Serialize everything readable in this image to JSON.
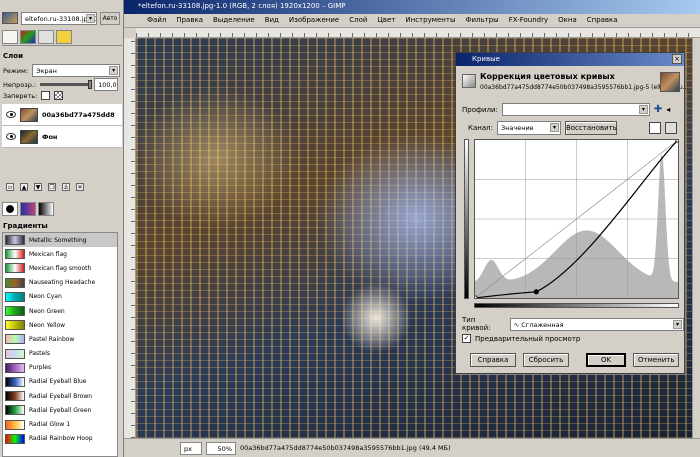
{
  "dock": {
    "image_selector": "eltefon.ru-33108.jpg-1",
    "auto_button": "Авто",
    "layers_title": "Слои",
    "mode_label": "Режим:",
    "mode_value": "Экран",
    "opacity_label": "Непрозр.:",
    "opacity_value": "100,0",
    "lock_label": "Запереть:",
    "layers": [
      {
        "name": "00a36bd77a475dd8"
      },
      {
        "name": "Фон"
      }
    ],
    "gradients_title": "Градиенты",
    "gradients": [
      {
        "name": "Metallic Something",
        "colors": [
          "#2a2a3a",
          "#c8c8d8",
          "#2a2a3a"
        ]
      },
      {
        "name": "Mexican flag",
        "colors": [
          "#1a9a3a",
          "#ffffff",
          "#d02020"
        ]
      },
      {
        "name": "Mexican flag smooth",
        "colors": [
          "#1a9a3a",
          "#ffffff",
          "#d02020"
        ]
      },
      {
        "name": "Nauseating Headache",
        "colors": [
          "#4a8a2a",
          "#a06030",
          "#404040"
        ]
      },
      {
        "name": "Neon Cyan",
        "colors": [
          "#00ffff",
          "#00aaaa",
          "#008080"
        ]
      },
      {
        "name": "Neon Green",
        "colors": [
          "#30ff30",
          "#20a020",
          "#106010"
        ]
      },
      {
        "name": "Neon Yellow",
        "colors": [
          "#ffff30",
          "#c0c000",
          "#808000"
        ]
      },
      {
        "name": "Pastel Rainbow",
        "colors": [
          "#ffb0b0",
          "#b0ffb0",
          "#b0b0ff"
        ]
      },
      {
        "name": "Pastels",
        "colors": [
          "#f0c0e0",
          "#c0e0f0",
          "#e0f0c0"
        ]
      },
      {
        "name": "Purples",
        "colors": [
          "#402060",
          "#a060c0",
          "#e0c0f0"
        ]
      },
      {
        "name": "Radial Eyeball Blue",
        "colors": [
          "#000000",
          "#3060c0",
          "#ffffff"
        ]
      },
      {
        "name": "Radial Eyeball Brown",
        "colors": [
          "#000000",
          "#804020",
          "#ffffff"
        ]
      },
      {
        "name": "Radial Eyeball Green",
        "colors": [
          "#000000",
          "#20a040",
          "#ffffff"
        ]
      },
      {
        "name": "Radial Glow 1",
        "colors": [
          "#ff6020",
          "#ffc040",
          "#ffffff"
        ]
      },
      {
        "name": "Radial Rainbow Hoop",
        "colors": [
          "#ff0000",
          "#00ff00",
          "#0000ff"
        ]
      }
    ]
  },
  "window": {
    "title": "*eltefon.ru-33108.jpg-1.0 (RGB, 2 слоя) 1920x1200 – GIMP",
    "menus": [
      "Файл",
      "Правка",
      "Выделение",
      "Вид",
      "Изображение",
      "Слой",
      "Цвет",
      "Инструменты",
      "Фильтры",
      "FX-Foundry",
      "Окна",
      "Справка"
    ]
  },
  "status": {
    "unit": "px",
    "zoom": "50%",
    "info": "00a36bd77a475dd8774e50b037498a3595576bb1.jpg (49,4 МБ)"
  },
  "curves": {
    "window_title": "Кривые",
    "heading": "Коррекция цветовых кривых",
    "subheading": "00a36bd77a475dd8774e50b037498a3595576bb1.jpg-5 (eltefon.ru...",
    "profiles_label": "Профили:",
    "channel_label": "Канал:",
    "channel_value": "Значение",
    "reset_button": "Восстановить",
    "curve_type_label": "Тип кривой:",
    "curve_type_value": "Сглаженная",
    "preview_label": "Предварительный просмотр",
    "preview_checked": true,
    "help_button": "Справка",
    "reset_all_button": "Сбросить",
    "ok_button": "OK",
    "cancel_button": "Отменить",
    "points": [
      [
        0,
        0
      ],
      [
        77,
        10
      ],
      [
        255,
        255
      ]
    ]
  }
}
